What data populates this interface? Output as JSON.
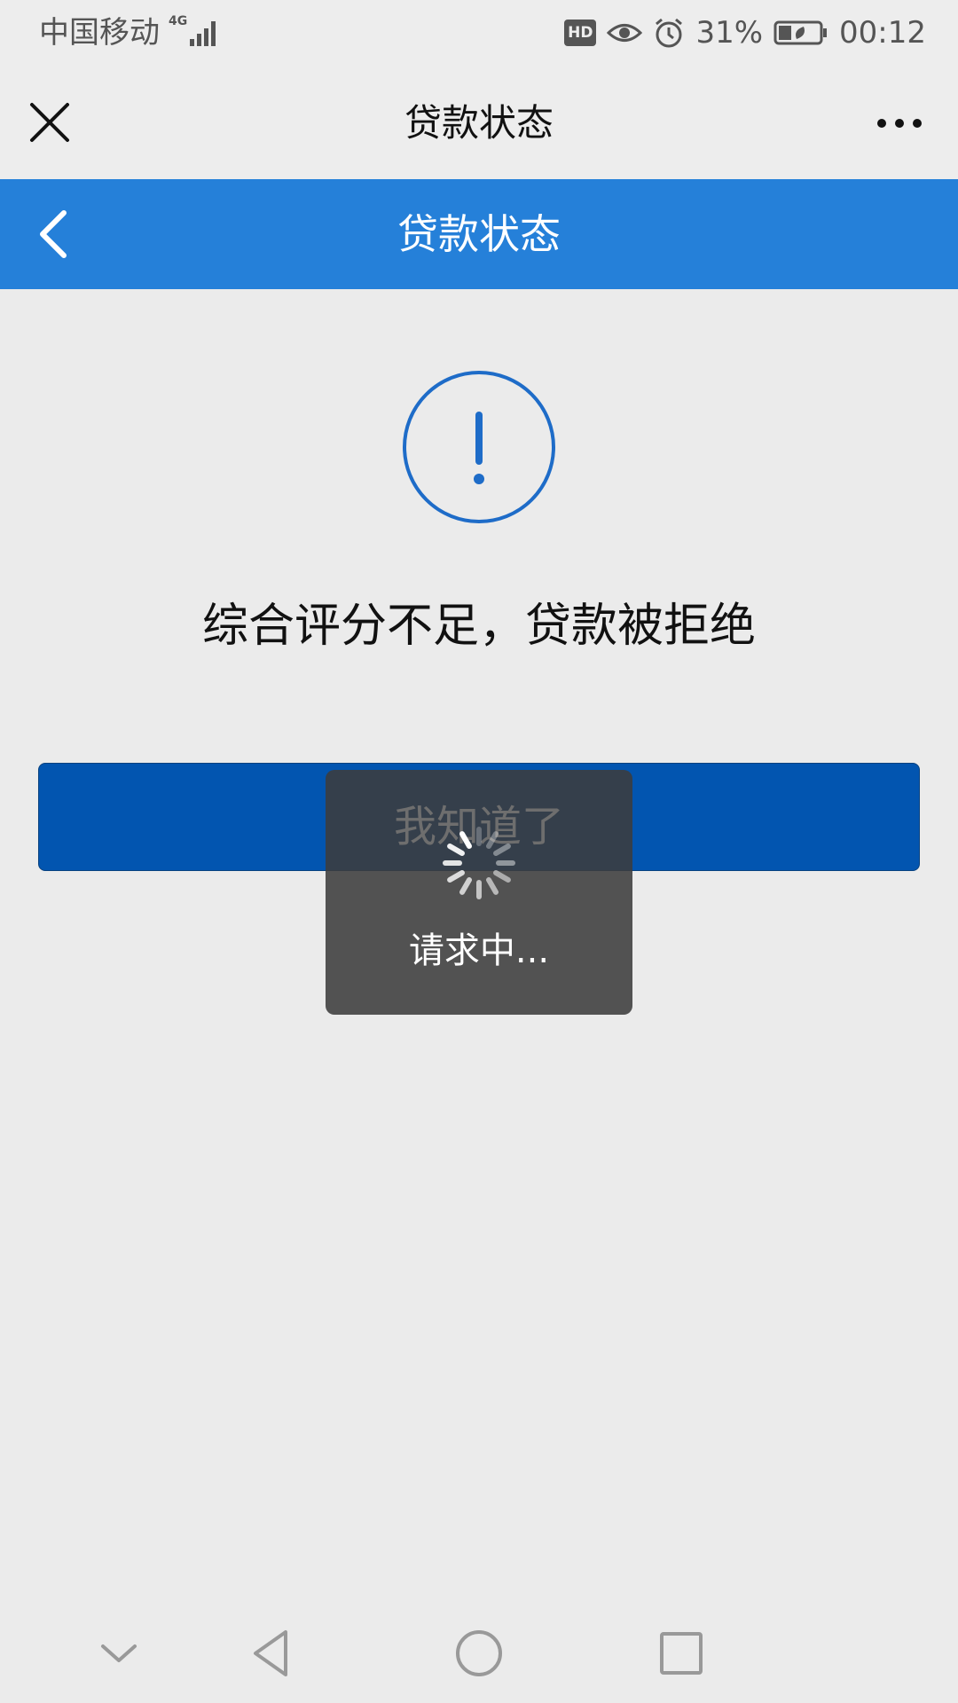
{
  "status_bar": {
    "carrier": "中国移动",
    "network_type": "4G",
    "hd_badge": "HD",
    "battery_percent": "31%",
    "battery_level": 0.31,
    "time": "00:12",
    "icons": [
      "signal-icon",
      "hd-icon",
      "eye-icon",
      "alarm-icon",
      "battery-icon"
    ]
  },
  "title_bar": {
    "title": "贷款状态",
    "close_icon": "close-icon",
    "more_icon": "more-icon"
  },
  "app_header": {
    "title": "贷款状态",
    "back_icon": "back-icon"
  },
  "content": {
    "alert_icon": "exclamation-circle-icon",
    "message": "综合评分不足，贷款被拒绝",
    "button_label": "我知道了"
  },
  "toast": {
    "text": "请求中..."
  },
  "nav_bar": {
    "icons": [
      "chevron-down-icon",
      "back-triangle-icon",
      "home-circle-icon",
      "recents-square-icon"
    ]
  },
  "colors": {
    "header_blue": "#2580d9",
    "button_blue": "#0255b0",
    "icon_blue": "#1e6cc8",
    "background": "#ebebeb"
  }
}
